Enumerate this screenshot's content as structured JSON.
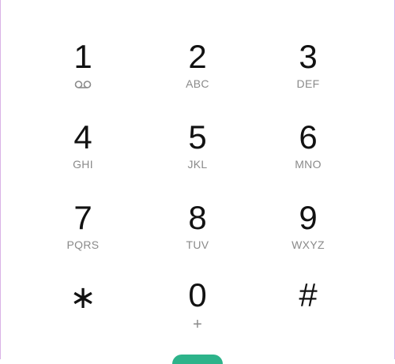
{
  "dialpad": {
    "keys": [
      {
        "digit": "1",
        "sub": "",
        "sub_icon": "voicemail-icon"
      },
      {
        "digit": "2",
        "sub": "ABC"
      },
      {
        "digit": "3",
        "sub": "DEF"
      },
      {
        "digit": "4",
        "sub": "GHI"
      },
      {
        "digit": "5",
        "sub": "JKL"
      },
      {
        "digit": "6",
        "sub": "MNO"
      },
      {
        "digit": "7",
        "sub": "PQRS"
      },
      {
        "digit": "8",
        "sub": "TUV"
      },
      {
        "digit": "9",
        "sub": "WXYZ"
      },
      {
        "digit": "∗",
        "sub": ""
      },
      {
        "digit": "0",
        "sub": "+"
      },
      {
        "digit": "#",
        "sub": ""
      }
    ],
    "call_button_color": "#2db38a",
    "digit_color": "#121212",
    "sub_color": "#8a8a8a"
  }
}
